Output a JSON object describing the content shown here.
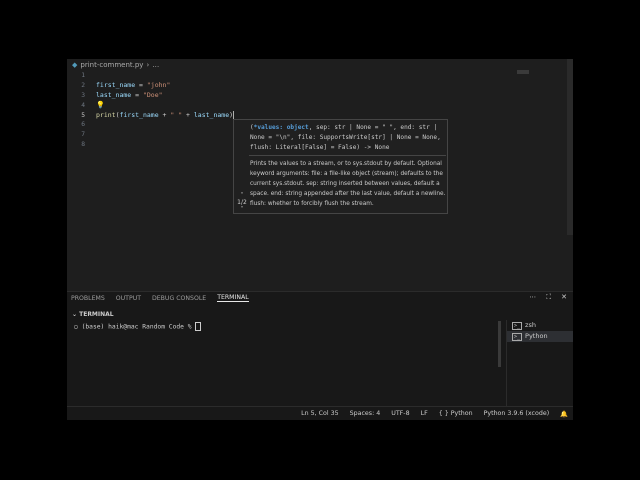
{
  "breadcrumb": {
    "file": "print-comment.py",
    "rest": "…"
  },
  "lines": [
    "1",
    "2",
    "3",
    "4",
    "5",
    "6",
    "7",
    "8"
  ],
  "code": {
    "l2_var": "first_name",
    "l2_op": " = ",
    "l2_str": "\"john\"",
    "l3_var": "last_name",
    "l3_op": " = ",
    "l3_str": "\"Doe\"",
    "l5_fn": "print",
    "l5_open": "(",
    "l5_var1": "first_name",
    "l5_plus1": " + ",
    "l5_space": "\" \"",
    "l5_plus2": " + ",
    "l5_var2": "last_name",
    "l5_close": ")"
  },
  "hover": {
    "sig_open": "(",
    "sig_values": "*values: object",
    "sig_rest1": ", sep: str | None = \" \", end: str |",
    "sig_line2": "None = \"\\n\", file: SupportsWrite[str] | None = None,",
    "sig_line3": "flush: Literal[False] = False) -> None",
    "doc1": "Prints the values to a stream, or to sys.stdout by default. Optional",
    "doc2": "keyword arguments: file: a file-like object (stream); defaults to the",
    "doc3": "current sys.stdout. sep: string inserted between values, default a",
    "doc4": "space. end: string appended after the last value, default a newline.",
    "doc5": "flush: whether to forcibly flush the stream.",
    "overload": "1/2"
  },
  "panel": {
    "tabs": [
      "PROBLEMS",
      "OUTPUT",
      "DEBUG CONSOLE",
      "TERMINAL"
    ],
    "header": "TERMINAL",
    "prompt": "(base) haik@mac Random Code % ",
    "terminals": [
      "zsh",
      "Python"
    ]
  },
  "status": {
    "position": "Ln 5, Col 35",
    "spaces": "Spaces: 4",
    "encoding": "UTF-8",
    "eol": "LF",
    "language": "Python",
    "interpreter": "Python 3.9.6 (xcode)"
  }
}
